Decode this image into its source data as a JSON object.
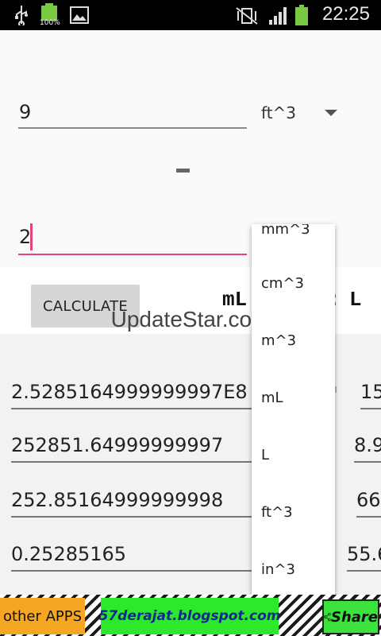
{
  "status_bar": {
    "time": "22:25",
    "battery_percent_label": "100%"
  },
  "converter": {
    "input_value": "9",
    "input_unit": "ft^3",
    "operator": "-",
    "second_value": "2",
    "calculate_label": "CALCULATE",
    "from_unit_display": "mL",
    "to_unit_display": "L",
    "colon": ":"
  },
  "watermark": "UpdateStar.com",
  "results_left": [
    "2.5285164999999997E8",
    "252851.64999999997",
    "252.85164999999998",
    "0.25285165"
  ],
  "results_right": [
    "15",
    "8.9",
    "66",
    "55.6"
  ],
  "results_right_partial_label": "3",
  "dropdown": {
    "items": [
      "mm^3",
      "cm^3",
      "m^3",
      "mL",
      "L",
      "ft^3",
      "in^3"
    ]
  },
  "banner": {
    "other_apps": "other APPS",
    "blog": "57derajat.blogspot.com",
    "share": "Share"
  },
  "colors": {
    "accent_pink": "#e0457b",
    "banner_green": "#2ee82e",
    "banner_orange": "#f5a623"
  }
}
